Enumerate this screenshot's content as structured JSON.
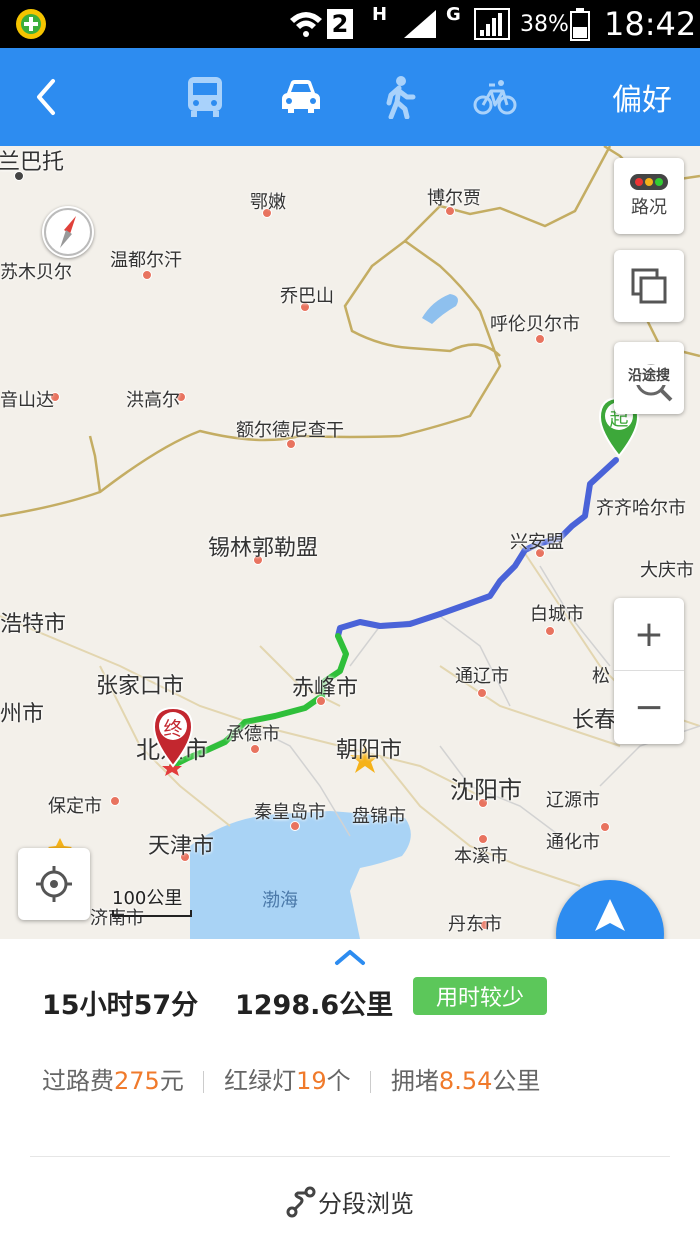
{
  "status_bar": {
    "sim_badge": "2",
    "net_h": "H",
    "net_g": "G",
    "battery": "38%",
    "time": "18:42"
  },
  "top_bar": {
    "back_icon": "chevron-left-icon",
    "modes": [
      "bus-icon",
      "car-icon",
      "walk-icon",
      "bike-icon"
    ],
    "selected_mode": "car-icon",
    "prefs_label": "偏好"
  },
  "map": {
    "labels": {
      "l1": "兰巴托",
      "l2": "鄂嫩",
      "l3": "博尔贾",
      "l4": "温都尔汗",
      "l5": "苏木贝尔",
      "l6": "乔巴山",
      "l7": "呼伦贝尔市",
      "l8": "音山达",
      "l9": "洪高尔",
      "l10": "额尔德尼查干",
      "l11": "兴安盟",
      "l12": "齐齐哈尔市",
      "l13": "锡林郭勒盟",
      "l14": "大庆市",
      "l15": "白城市",
      "l16": "浩特市",
      "l17": "张家口市",
      "l18": "赤峰市",
      "l19": "通辽市",
      "l20": "松",
      "l21": "州市",
      "l22": "北京市",
      "l23": "承德市",
      "l24": "朝阳市",
      "l25": "长春",
      "l26": "沈阳市",
      "l27": "辽源市",
      "l28": "保定市",
      "l29": "秦皇岛市",
      "l30": "盘锦市",
      "l31": "天津市",
      "l32": "通化市",
      "l33": "本溪市",
      "l34": "渤海",
      "l35": "济南市",
      "l36": "丹东市"
    },
    "start_marker": "起",
    "end_marker": "终",
    "scale_label": "100公里",
    "traffic_label": "路况",
    "search_along_label": "沿途搜",
    "layers_icon": "layers-icon",
    "locate_icon": "locate-icon",
    "compass_icon": "compass-icon",
    "zoom_in": "+",
    "zoom_out": "−",
    "route_colors": {
      "highway": "#4a63d8",
      "smooth": "#2fbf3a"
    }
  },
  "nav_button": {
    "label": "导航",
    "icon": "navigation-arrow-icon"
  },
  "summary": {
    "expand_icon": "chevron-up-icon",
    "time": "15小时57分",
    "distance": "1298.6公里",
    "tag": "用时较少"
  },
  "details": {
    "toll_prefix": "过路费",
    "toll_value": "275",
    "toll_unit": "元",
    "lights_prefix": "红绿灯",
    "lights_value": "19",
    "lights_unit": "个",
    "jam_prefix": "拥堵",
    "jam_value": "8.54",
    "jam_unit": "公里"
  },
  "segment_view": {
    "label": "分段浏览",
    "icon": "route-icon"
  }
}
